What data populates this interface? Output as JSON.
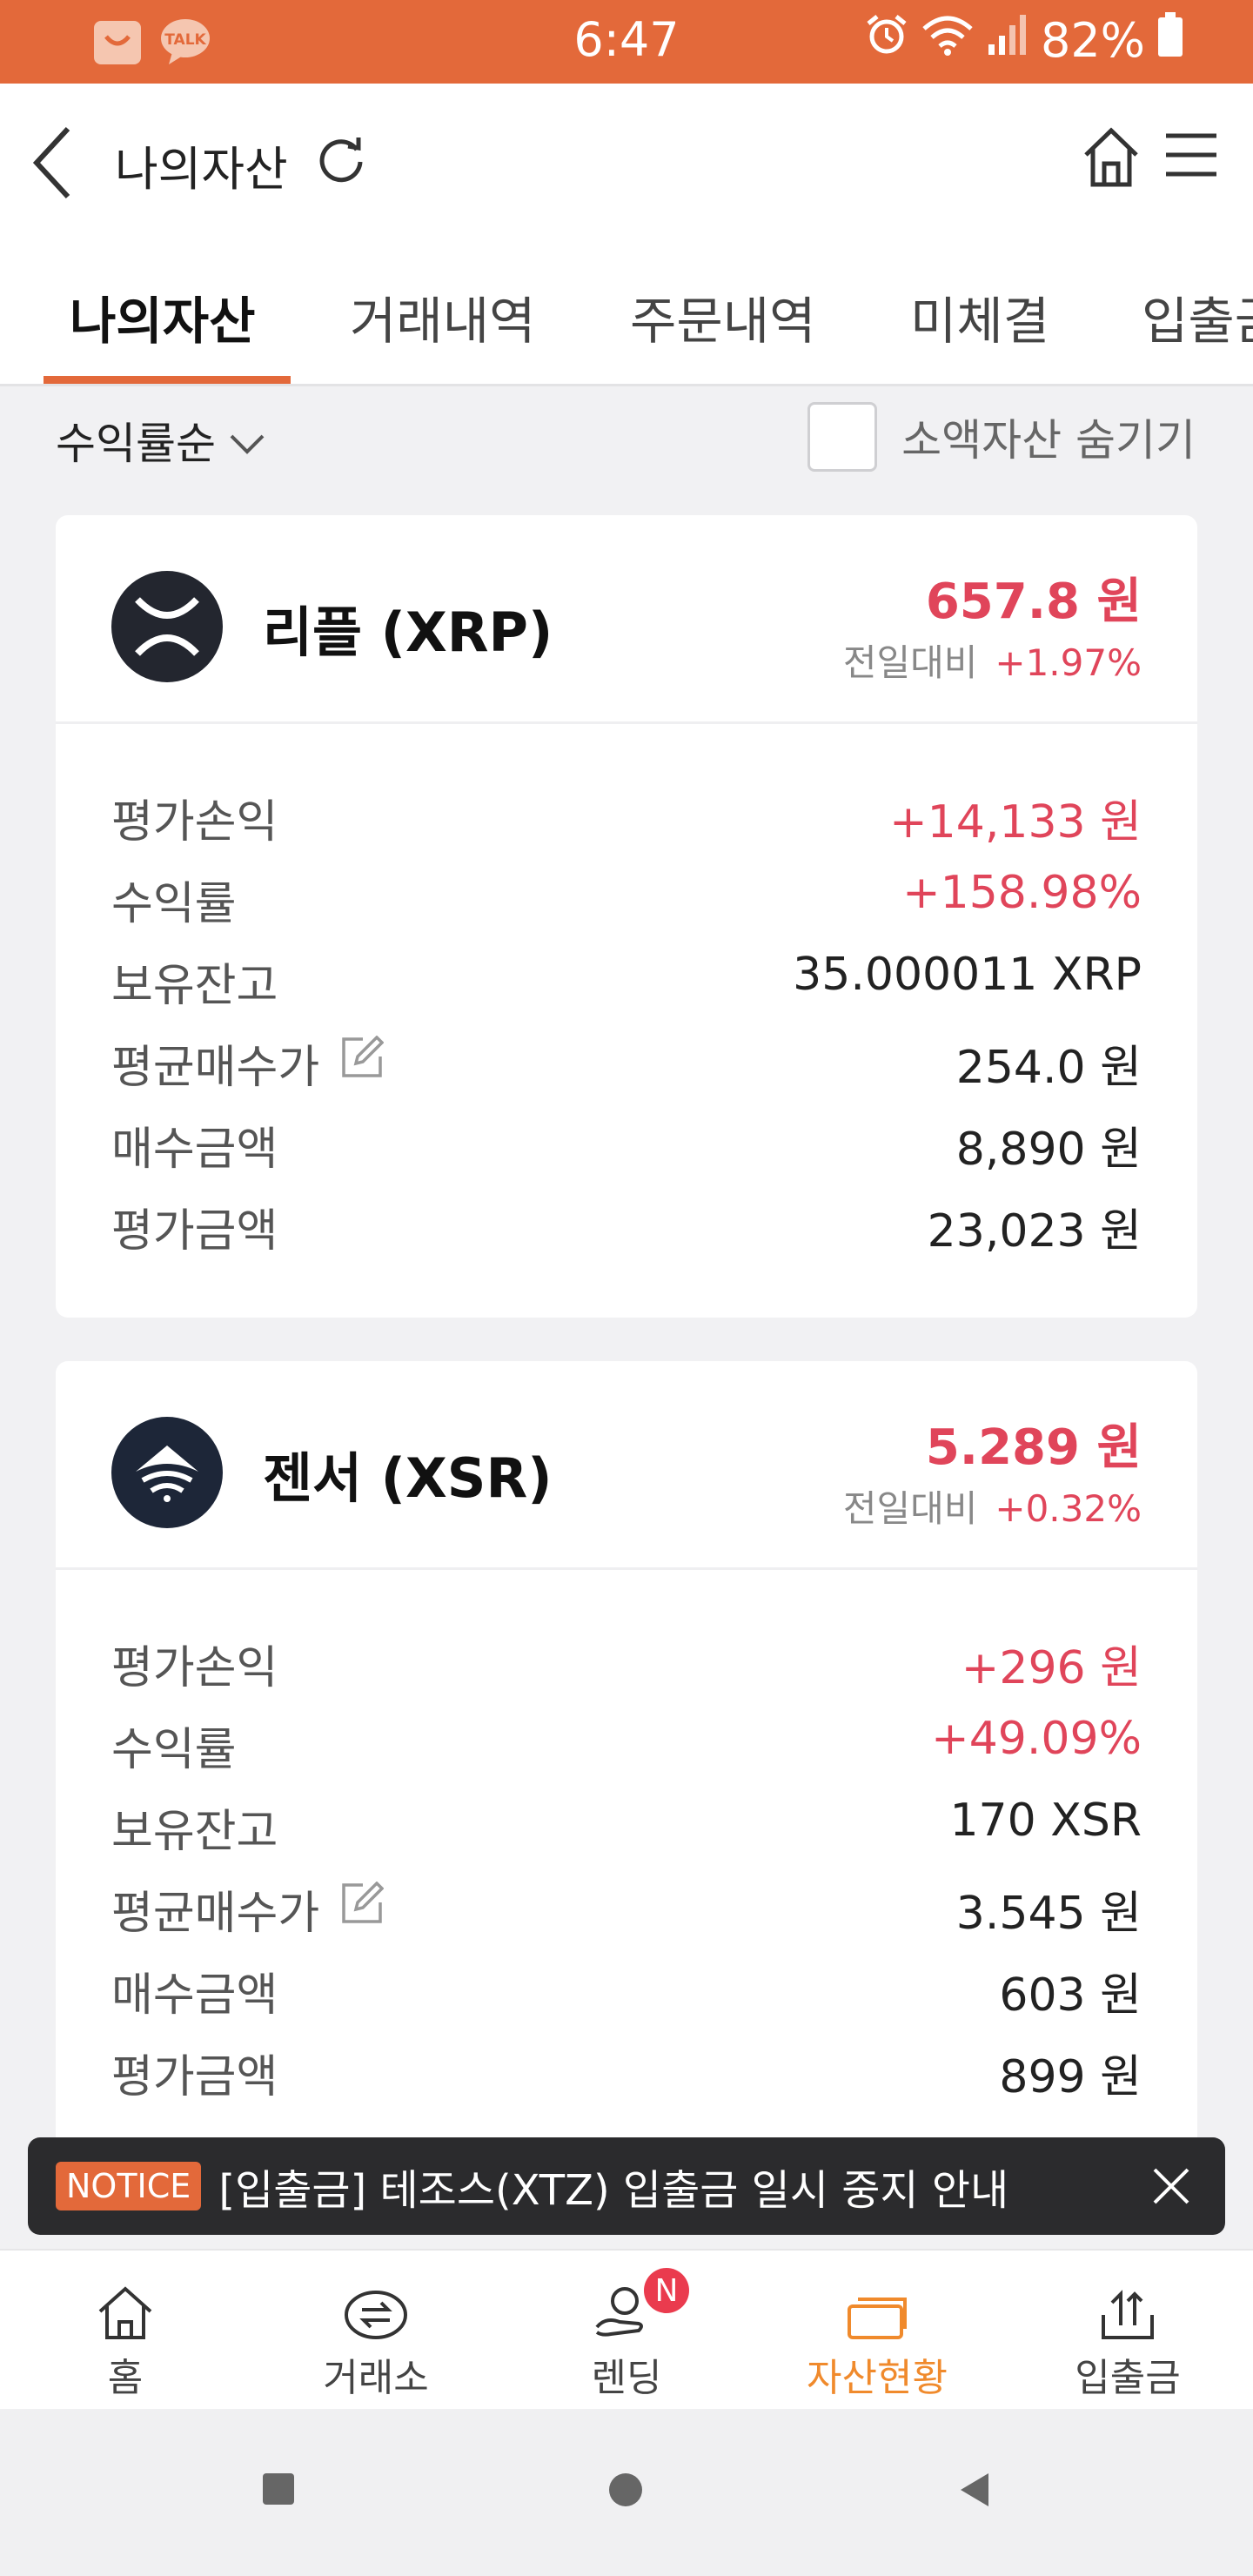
{
  "status_bar": {
    "time": "6:47",
    "battery": "82%",
    "icons": [
      "shopping-icon",
      "kakaotalk-icon",
      "alarm-icon",
      "wifi-icon",
      "signal-icon",
      "battery-icon"
    ],
    "talk_label": "TALK"
  },
  "header": {
    "title": "나의자산"
  },
  "tabs": [
    {
      "label": "나의자산",
      "active": true
    },
    {
      "label": "거래내역"
    },
    {
      "label": "주문내역"
    },
    {
      "label": "미체결"
    },
    {
      "label": "입출금"
    }
  ],
  "filter": {
    "sort_label": "수익률순",
    "hide_small_label": "소액자산 숨기기"
  },
  "assets": [
    {
      "name": "리플 (XRP)",
      "price": "657.8 원",
      "change_label": "전일대비",
      "change_pct": "+1.97%",
      "rows": [
        {
          "label": "평가손익",
          "value": "+14,133 원"
        },
        {
          "label": "수익률",
          "value": "+158.98%"
        },
        {
          "label": "보유잔고",
          "value": "35.000011 XRP"
        },
        {
          "label": "평균매수가",
          "value": "254.0 원"
        },
        {
          "label": "매수금액",
          "value": "8,890 원"
        },
        {
          "label": "평가금액",
          "value": "23,023 원"
        }
      ]
    },
    {
      "name": "젠서 (XSR)",
      "price": "5.289 원",
      "change_label": "전일대비",
      "change_pct": "+0.32%",
      "rows": [
        {
          "label": "평가손익",
          "value": "+296 원"
        },
        {
          "label": "수익률",
          "value": "+49.09%"
        },
        {
          "label": "보유잔고",
          "value": "170 XSR"
        },
        {
          "label": "평균매수가",
          "value": "3.545 원"
        },
        {
          "label": "매수금액",
          "value": "603 원"
        },
        {
          "label": "평가금액",
          "value": "899 원"
        }
      ]
    }
  ],
  "notice": {
    "badge": "NOTICE",
    "text": "[입출금] 테조스(XTZ) 입출금 일시 중지 안내"
  },
  "bottom_nav": [
    {
      "label": "홈",
      "icon": "home-icon"
    },
    {
      "label": "거래소",
      "icon": "exchange-icon"
    },
    {
      "label": "렌딩",
      "icon": "lending-icon",
      "badge": "N"
    },
    {
      "label": "자산현황",
      "icon": "wallet-icon",
      "active": true
    },
    {
      "label": "입출금",
      "icon": "deposit-icon"
    }
  ],
  "colors": {
    "brand": "#e3693a",
    "positive": "#e0455a",
    "active_nav": "#f08a2c"
  }
}
